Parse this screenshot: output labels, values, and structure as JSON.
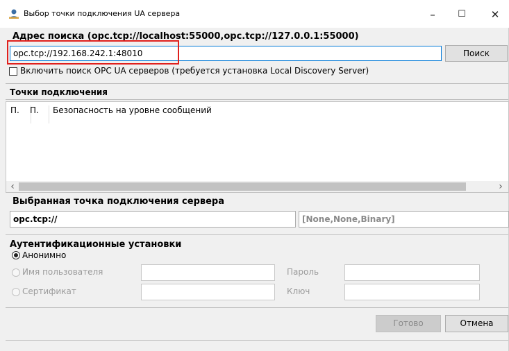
{
  "window": {
    "title": "Выбор точки подключения UA сервера",
    "controls": {
      "minimize": "–",
      "maximize": "☐",
      "close": "✕"
    }
  },
  "search": {
    "label": "Адрес поиска (opc.tcp://localhost:55000,opc.tcp://127.0.0.1:55000)",
    "value": "opc.tcp://192.168.242.1:48010",
    "button": "Поиск",
    "lds_checkbox": "Включить поиск OPC UA серверов (требуется установка Local Discovery Server)"
  },
  "endpoints": {
    "label": "Точки подключения",
    "columns": [
      "П.",
      "П.",
      "Безопасность на уровне сообщений"
    ],
    "scroll_left": "‹",
    "scroll_right": "›"
  },
  "selected": {
    "label": "Выбранная точка подключения сервера",
    "url": "opc.tcp://",
    "security": "[None,None,Binary]"
  },
  "auth": {
    "label": "Аутентификационные установки",
    "anonymous": "Анонимно",
    "username": "Имя пользователя",
    "password": "Пароль",
    "certificate": "Сертификат",
    "key": "Ключ"
  },
  "footer": {
    "ok": "Готово",
    "cancel": "Отмена"
  },
  "colors": {
    "highlight": "#e0201d",
    "window_bg": "#f0f0f0",
    "accent": "#0078d7"
  }
}
